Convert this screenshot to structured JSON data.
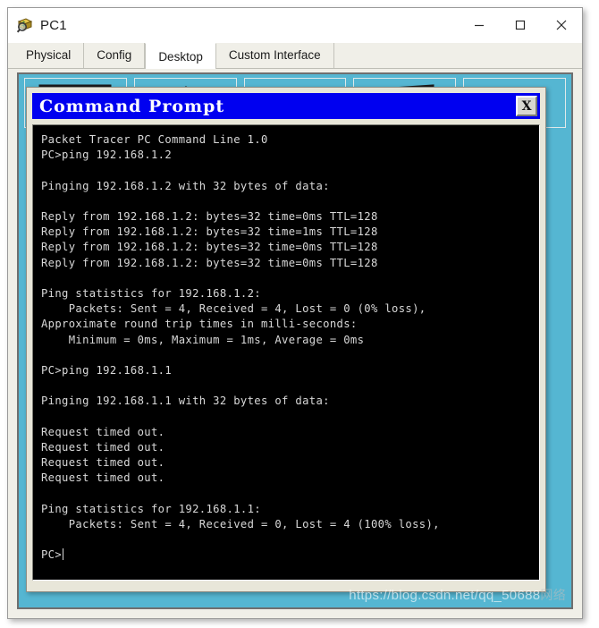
{
  "window": {
    "title": "PC1",
    "icon": "packet-tracer-device-icon",
    "controls": {
      "minimize": "—",
      "maximize": "□",
      "close": "✕"
    }
  },
  "tabs": [
    {
      "label": "Physical",
      "active": false
    },
    {
      "label": "Config",
      "active": false
    },
    {
      "label": "Desktop",
      "active": true
    },
    {
      "label": "Custom Interface",
      "active": false
    }
  ],
  "desktop": {
    "background_color": "#55b6d2",
    "icons": [
      {
        "name": "ip-configuration-icon"
      },
      {
        "name": "dial-up-icon"
      },
      {
        "name": "terminal-icon"
      },
      {
        "name": "command-prompt-icon"
      },
      {
        "name": "web-browser-icon"
      }
    ]
  },
  "command_prompt": {
    "title": "Command Prompt",
    "titlebar_color": "#0000f0",
    "close_label": "X",
    "screen_background": "#000000",
    "screen_text_color": "#d8d8d8",
    "lines": [
      "Packet Tracer PC Command Line 1.0",
      "PC>ping 192.168.1.2",
      "",
      "Pinging 192.168.1.2 with 32 bytes of data:",
      "",
      "Reply from 192.168.1.2: bytes=32 time=0ms TTL=128",
      "Reply from 192.168.1.2: bytes=32 time=1ms TTL=128",
      "Reply from 192.168.1.2: bytes=32 time=0ms TTL=128",
      "Reply from 192.168.1.2: bytes=32 time=0ms TTL=128",
      "",
      "Ping statistics for 192.168.1.2:",
      "    Packets: Sent = 4, Received = 4, Lost = 0 (0% loss),",
      "Approximate round trip times in milli-seconds:",
      "    Minimum = 0ms, Maximum = 1ms, Average = 0ms",
      "",
      "PC>ping 192.168.1.1",
      "",
      "Pinging 192.168.1.1 with 32 bytes of data:",
      "",
      "Request timed out.",
      "Request timed out.",
      "Request timed out.",
      "Request timed out.",
      "",
      "Ping statistics for 192.168.1.1:",
      "    Packets: Sent = 4, Received = 0, Lost = 4 (100% loss),",
      "",
      "PC>"
    ],
    "prompt_cursor": true
  },
  "watermark": {
    "url": "https://blog.csdn.net/qq_50688",
    "suffix": "网络"
  }
}
